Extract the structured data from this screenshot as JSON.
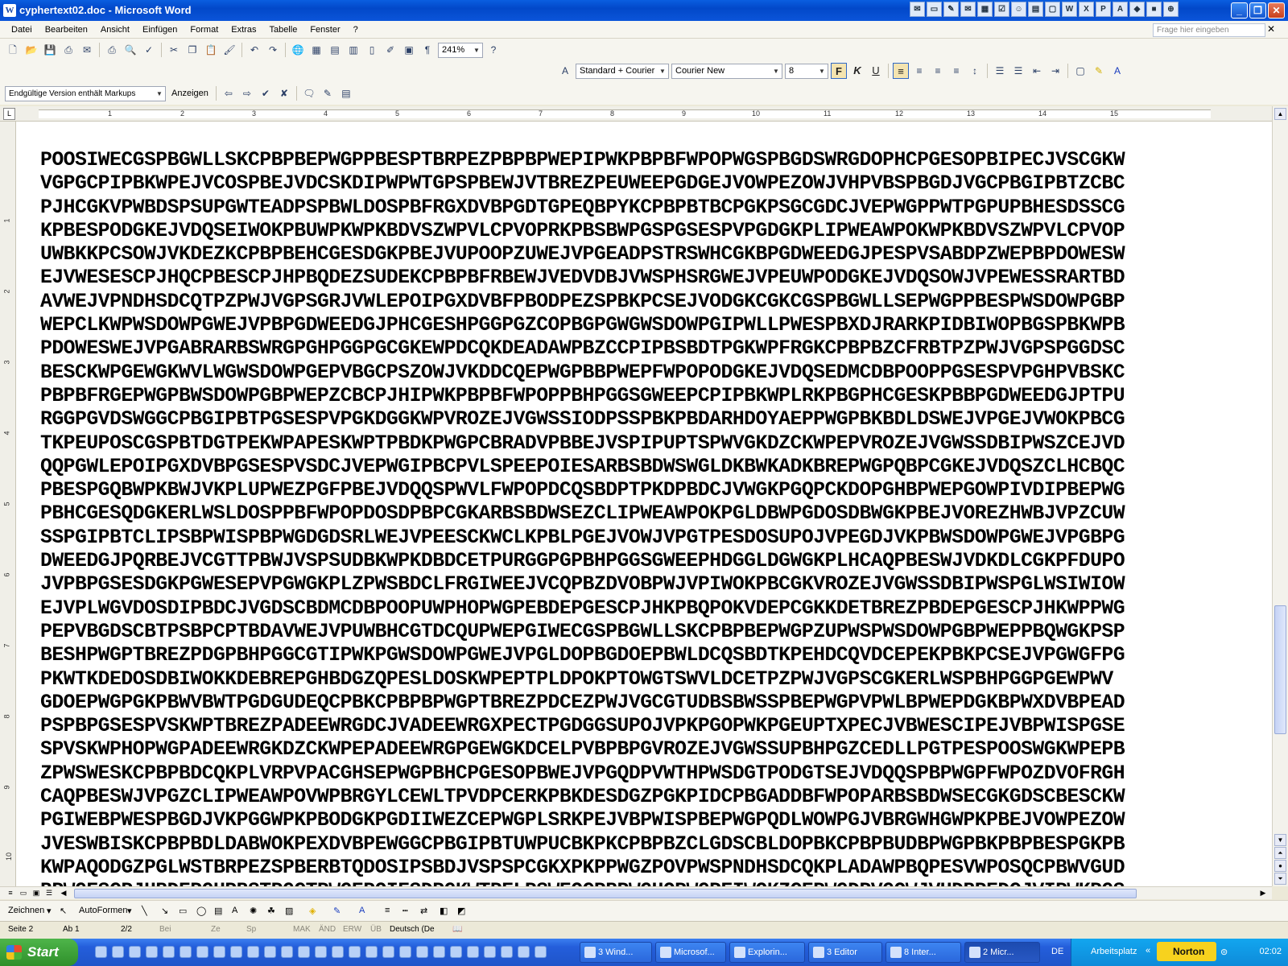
{
  "window": {
    "title": "cyphertext02.doc - Microsoft Word",
    "app_icon": "W"
  },
  "menu": {
    "items": [
      "Datei",
      "Bearbeiten",
      "Ansicht",
      "Einfügen",
      "Format",
      "Extras",
      "Tabelle",
      "Fenster",
      "?"
    ],
    "help_placeholder": "Frage hier eingeben"
  },
  "toolbar": {
    "zoom": "241%",
    "style": "Standard + Courier",
    "font": "Courier New",
    "size": "8",
    "bold": "F",
    "italic": "K",
    "underline": "U",
    "markup_view": "Endgültige Version enthält Markups",
    "show_label": "Anzeigen"
  },
  "ruler": {
    "numbers": [
      "1",
      "2",
      "3",
      "4",
      "5",
      "6",
      "7",
      "8",
      "9",
      "10",
      "11",
      "12",
      "13",
      "14",
      "15"
    ],
    "vnumbers": [
      "1",
      "2",
      "3",
      "4",
      "5",
      "6",
      "7",
      "8",
      "9",
      "10"
    ]
  },
  "document": {
    "lines": [
      "POOSIWECGSPBGWLLSKCPBPBEPWGPPBESPTBRPEZPBPBPWEPIPWKPBPBFWPOPWGSPBGDSWRGDOPHCPGESOPBIPECJVSCGKW",
      "VGPGCPIPBKWPEJVCOSPBEJVDCSKDIPWPWTGPSPBEWJVTBREZPEUWEEPGDGEJVOWPEZOWJVHPVBSPBGDJVGCPBGIPBTZCBC",
      "PJHCGKVPWBDSPSUPGWTEADPSPBWLDOSPBFRGXDVBPGDTGPEQBPYKCPBPBTBCPGKPSGCGDCJVEPWGPPWTPGPUPBHESDSSCG",
      "KPBESPODGKEJVDQSEIWOKPBUWPKWPKBDVSZWPVLCPVOPRKPBSBWPGSPGSESPVPGDGKPLIPWEAWPOKWPKBDVSZWPVLCPVOP",
      "UWBKKPCSOWJVKDEZKCPBPBEHCGESDGKPBEJVUPOOPZUWEJVPGEADPSTRSWHCGKBPGDWEEDGJPESPVSABDPZWEPBPDOWESW",
      "EJVWESESCPJHQCPBESCPJHPBQDEZSUDEKCPBPBFRBEWJVEDVDBJVWSPHSRGWEJVPEUWPODGKEJVDQSOWJVPEWESSRARTBD",
      "AVWEJVPNDHSDCQTPZPWJVGPSGRJVWLEPOIPGXDVBFPBODPEZSPBKPCSEJVODGKCGKCGSPBGWLLSEPWGPPBESPWSDOWPGBP",
      "WEPCLKWPWSDOWPGWEJVPBPGDWEEDGJPHCGESHPGGPGZCOPBGPGWGWSDOWPGIPWLLPWESPBXDJRARKPIDBIWOPBGSPBKWPB",
      "PDOWESWEJVPGABRARBSWRGPGHPGGPGCGKEWPDCQKDEADAWPBZCCPIPBSBDTPGKWPFRGKCPBPBZCFRBTPZPWJVGPSPGGDSC",
      "BESCKWPGEWGKWVLWGWSDOWPGEPVBGCPSZOWJVKDDCQEPWGPBBPWEPFWPOPODGKEJVDQSEDMCDBPOOPPGSESPVPGHPVBSKC",
      "PBPBFRGEPWGPBWSDOWPGBPWEPZCBCPJHIPWKPBPBFWPOPPBHPGGSGWEEPCPIPBKWPLRKPBGPHCGESKPBBPGDWEEDGJPTPU",
      "RGGPGVDSWGGCPBGIPBTPGSESPVPGKDGGKWPVROZEJVGWSSIODPSSPBKPBDARHDOYAEPPWGPBKBDLDSWEJVPGEJVWOKPBCG",
      "TKPEUPOSCGSPBTDGTPEKWPAPESKWPTPBDKPWGPCBRADVPBBEJVSPIPUPTSPWVGKDZCKWPEPVROZEJVGWSSDBIPWSZCEJVD",
      "QQPGWLEPOIPGXDVBPGSESPVSDCJVEPWGIPBCPVLSPEEPOIESARBSBDWSWGLDKBWKADKBREPWGPQBPCGKEJVDQSZCLHCBQC",
      "PBESPGQBWPKBWJVKPLUPWEZPGFPBEJVDQQSPWVLFWPOPDCQSBDPTPKDPBDCJVWGKPGQPCKDOPGHBPWEPGOWPIVDIPBEPWG",
      "PBHCGESQDGKERLWSLDOSPPBFWPOPDOSDPBPCGKARBSBDWSEZCLIPWEAWPOKPGLDBWPGDOSDBWGKPBEJVOREZHWBJVPZCUW",
      "SSPGIPBTCLIPSBPWISPBPWGDGDSRLWEJVPEESCKWCLKPBLPGEJVOWJVPGTPESDOSUPOJVPEGDJVKPBWSDOWPGWEJVPGBPG",
      "DWEEDGJPQRBEJVCGTTPBWJVSPSUDBKWPKDBDCETPURGGPGPBHPGGSGWEEPHDGGLDGWGKPLHCAQPBESWJVDKDLCGKPFDUPO",
      "JVPBPGSESDGKPGWESEPVPGWGKPLZPWSBDCLFRGIWEEJVCQPBZDVOBPWJVPIWOKPBCGKVROZEJVGWSSDBIPWSPGLWSIWIOW",
      "EJVPLWGVDOSDIPBDCJVGDSCBDMCDBPOOPUWPHOPWGPEBDEPGESCPJHKPBQPOKVDEPCGKKDETBREZPBDEPGESCPJHKWPPWG",
      "PEPVBGDSCBTPSBPCPTBDAVWEJVPUWBHCGTDCQUPWEPGIWECGSPBGWLLSKCPBPBEPWGPZUPWSPWSDOWPGBPWEPPBQWGKPSP",
      "BESHPWGPTBREZPDGPBHPGGCGTIPWKPGWSDOWPGWEJVPGLDOPBGDOEPBWLDCQSBDTKPEHDCQVDCEPEKPBKPCSEJVPGWGFPG",
      "PKWTKDEDOSDBIWOKKDEBREPGHBDGZQPESLDOSKWPEPTPLDPOKPTOWGTSWVLDCETPZPWJVGPSCGKERLWSPBHPGGPGEWPWV",
      "GDOEPWGPGKPBWVBWTPGDGUDEQCPBKCPBPBPWGPTBREZPDCEZPWJVGCGTUDBSBWSSPBEPWGPVPWLBPWEPDGKBPWXDVBPEAD",
      "PSPBPGSESPVSKWPTBREZPADEEWRGDCJVADEEWRGXPECTPGDGGSUPOJVPKPGOPWKPGEUPTXPECJVBWESCIPEJVBPWISPGSE",
      "SPVSKWPHOPWGPADEEWRGKDZCKWPEPADEEWRGPGEWGKDCELPVBPBPGVROZEJVGWSSUPBHPGZCEDLLPGTPESPOOSWGKWPEPB",
      "ZPWSWESKCPBPBDCQKPLVRPVPACGHSEPWGPBHCPGESOPBWEJVPGQDPVWTHPWSDGTPODGTSEJVDQQSPBPWGPFWPOZDVOFRGH",
      "CAQPBESWJVPGZCLIPWEAWPOVWPBRGYLCEWLTPVDPCERKPBKDESDGZPGKPIDCPBGADDBFWPOPARBSBDWSECGKGDSCBESCKW",
      "PGIWEBPWESPBGDJVKPGGWPKPBODGKPGDIIWEZCEPWGPLSRKPEJVBPWISPBEPWGPQDLWOWPGJVBRGWHGWPKPBEJVOWPEZOW",
      "JVESWBISKCPBPBDLDABWOKPEXDVBPEWGGCPBGIPBTUWPUCBKPKCPBPBZCLGDSCBLDOPBKCPBPBUDBPWGPBKPBPBESPGKPB",
      "KWPAQODGZPGLWSTBRPEZSPBERBTQDOSIPSBDJVSPSPCGKXPKPPWGZPOVPWSPNDHSDCQKPLADAWPBQPESVWPOSQCPBWVGUD",
      "BPWGESCPJHBDEPGUPBSTPGCTPWGEPOIESDPGKWTPELPSWEOCPBPWGHOPWGPEIWOKZCEPWGDPVGOWJVUDBPEDCJVIPWKPGS"
    ]
  },
  "drawing": {
    "draw": "Zeichnen",
    "autoshapes": "AutoFormen"
  },
  "status": {
    "page": "Seite 2",
    "section": "Ab 1",
    "pages": "2/2",
    "at": "Bei",
    "line": "Ze",
    "col": "Sp",
    "mak": "MAK",
    "and": "ÄND",
    "erw": "ERW",
    "ub": "ÜB",
    "language": "Deutsch (De"
  },
  "taskbar": {
    "start": "Start",
    "tasks": [
      "3 Wind...",
      "Microsof...",
      "Explorin...",
      "3 Editor",
      "8 Inter...",
      "2 Micr..."
    ],
    "lang": "DE",
    "arbeitsplatz": "Arbeitsplatz",
    "norton": "Norton",
    "clock": "02:02"
  }
}
